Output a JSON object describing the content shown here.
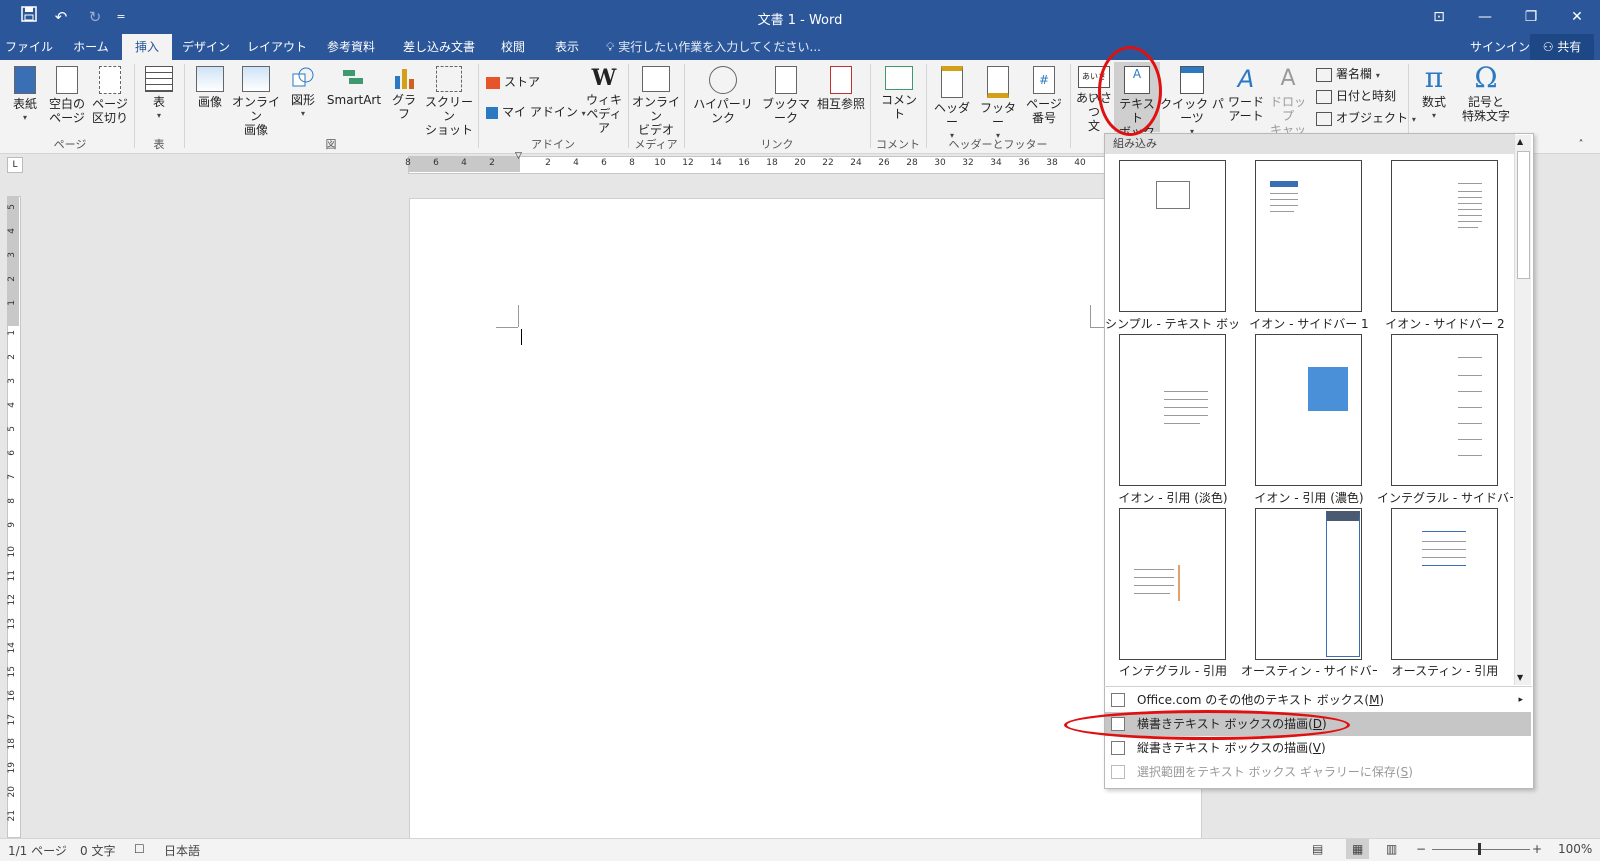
{
  "title_bar": {
    "title": "文書 1 - Word",
    "qat_more": "="
  },
  "tabs": [
    {
      "label": "ファイル"
    },
    {
      "label": "ホーム"
    },
    {
      "label": "挿入"
    },
    {
      "label": "デザイン"
    },
    {
      "label": "レイアウト"
    },
    {
      "label": "参考資料"
    },
    {
      "label": "差し込み文書"
    },
    {
      "label": "校閲"
    },
    {
      "label": "表示"
    }
  ],
  "tell_me": "実行したい作業を入力してください...",
  "account": {
    "signin": "サインイン",
    "share": "共有"
  },
  "ribbon": {
    "pages": {
      "cover": "表紙",
      "blank1": "空白の",
      "blank2": "ページ",
      "break1": "ページ",
      "break2": "区切り",
      "group": "ページ"
    },
    "tables": {
      "table": "表",
      "group": "表"
    },
    "illustrations": {
      "pictures": "画像",
      "online1": "オンライン",
      "online2": "画像",
      "shapes": "図形",
      "smartart": "SmartArt",
      "chart": "グラフ",
      "screenshot1": "スクリーン",
      "screenshot2": "ショット",
      "group": "図"
    },
    "addins": {
      "store": "ストア",
      "myaddins": "マイ アドイン",
      "wiki1": "ウィキ",
      "wiki2": "ペディア",
      "group": "アドイン"
    },
    "media": {
      "video1": "オンライン",
      "video2": "ビデオ",
      "group": "メディア"
    },
    "links": {
      "hyperlink": "ハイパーリンク",
      "bookmark": "ブックマーク",
      "crossref": "相互参照",
      "group": "リンク"
    },
    "comments": {
      "comment": "コメント",
      "group": "コメント"
    },
    "header_footer": {
      "header": "ヘッダー",
      "footer": "フッター",
      "pagenum1": "ページ",
      "pagenum2": "番号",
      "group": "ヘッダーとフッター"
    },
    "text": {
      "greeting1": "あいさつ",
      "greeting2": "文",
      "greeting_icon": "あいさつ",
      "textbox1": "テキスト",
      "textbox2": "ボックス",
      "quickparts": "クイック パーツ",
      "wordart1": "ワード",
      "wordart2": "アート",
      "dropcap1": "ドロップ",
      "dropcap2": "キャップ",
      "signature": "署名欄",
      "datetime": "日付と時刻",
      "object": "オブジェクト"
    },
    "symbols": {
      "equation": "数式",
      "symbol1": "記号と",
      "symbol2": "特殊文字"
    }
  },
  "ruler_numbers": [
    "8",
    "6",
    "4",
    "2",
    "2",
    "4",
    "6",
    "8",
    "10",
    "12",
    "14",
    "16",
    "18",
    "20",
    "22",
    "24",
    "26",
    "28",
    "30",
    "32",
    "34",
    "36",
    "38",
    "40"
  ],
  "vruler_numbers": [
    "5",
    "4",
    "3",
    "2",
    "1",
    "1",
    "2",
    "3",
    "4",
    "5",
    "6",
    "7",
    "8",
    "9",
    "10",
    "11",
    "12",
    "13",
    "14",
    "15",
    "16",
    "17",
    "18",
    "19",
    "20",
    "21"
  ],
  "gallery": {
    "header": "組み込み",
    "items": [
      {
        "label": "シンプル - テキスト ボック..."
      },
      {
        "label": "イオン - サイドバー 1"
      },
      {
        "label": "イオン - サイドバー 2"
      },
      {
        "label": "イオン - 引用 (淡色)"
      },
      {
        "label": "イオン - 引用 (濃色)"
      },
      {
        "label": "インテグラル - サイドバー"
      },
      {
        "label": "インテグラル - 引用"
      },
      {
        "label": "オースティン - サイドバー"
      },
      {
        "label": "オースティン - 引用"
      }
    ],
    "menu": [
      {
        "label": "Office.com のその他のテキスト ボックス(",
        "key": "M",
        "tail": ")"
      },
      {
        "label": "横書きテキスト ボックスの描画(",
        "key": "D",
        "tail": ")"
      },
      {
        "label": "縦書きテキスト ボックスの描画(",
        "key": "V",
        "tail": ")"
      },
      {
        "label": "選択範囲をテキスト ボックス ギャラリーに保存(",
        "key": "S",
        "tail": ")"
      }
    ]
  },
  "status": {
    "page": "1/1 ページ",
    "words": "0 文字",
    "lang": "日本語",
    "zoom": "100%"
  },
  "colors": {
    "accent": "#2b579a",
    "highlight_oval": "#e01010"
  }
}
